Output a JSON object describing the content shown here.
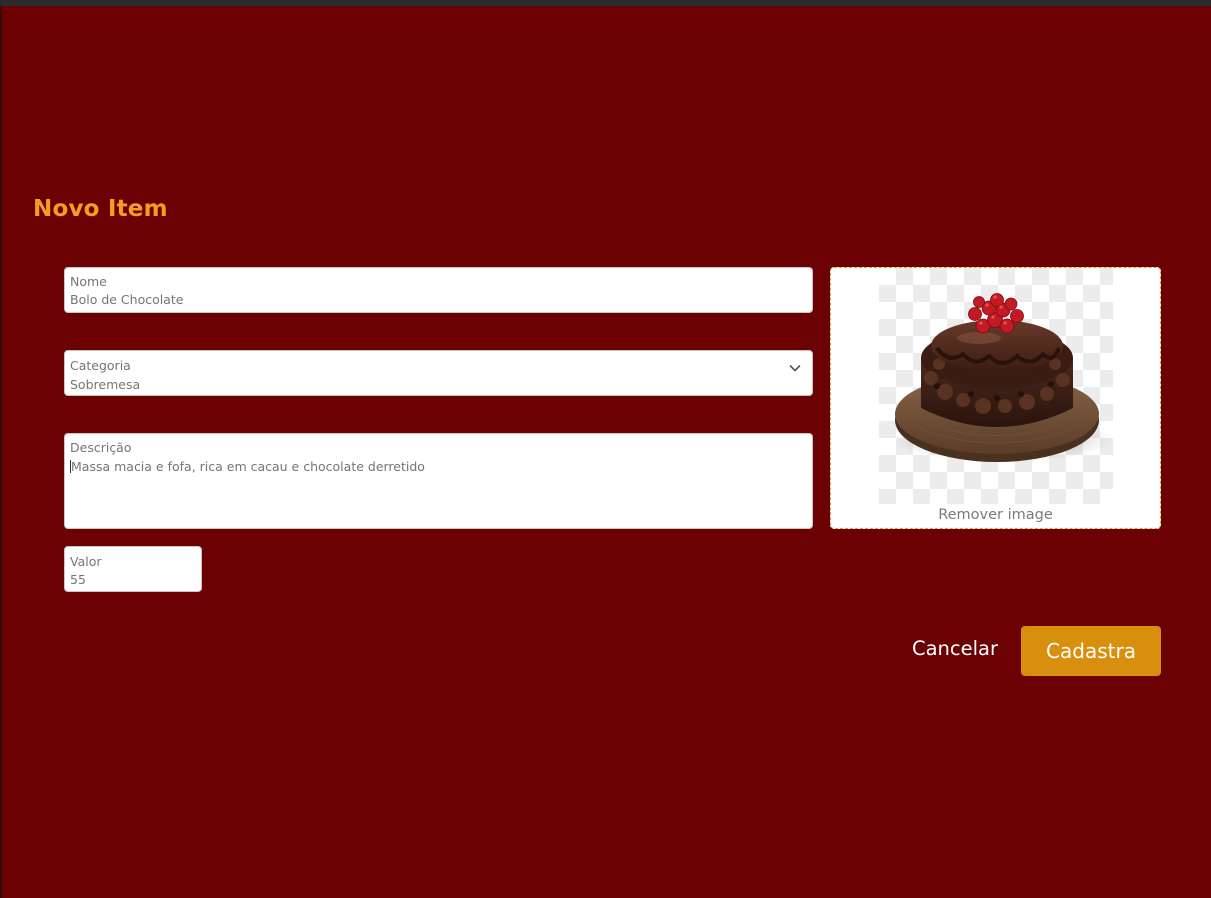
{
  "form": {
    "title": "Novo Item",
    "fields": {
      "nome": {
        "label": "Nome",
        "value": "Bolo de Chocolate"
      },
      "categoria": {
        "label": "Categoria",
        "value": "Sobremesa"
      },
      "descricao": {
        "label": "Descrição",
        "value": "Massa macia e fofa, rica em cacau e chocolate derretido"
      },
      "valor": {
        "label": "Valor",
        "value": "55"
      }
    },
    "image": {
      "remove_label": "Remover image"
    },
    "buttons": {
      "cancel_label": "Cancelar",
      "submit_label": "Cadastra"
    }
  },
  "colors": {
    "background": "#6b0103",
    "title": "#f0a020",
    "submit_button": "#d98f0e",
    "dropzone_border": "#e0a030"
  },
  "icons": {
    "categoria_dropdown": "chevron-down-icon",
    "image_preview": "chocolate-cake-image"
  }
}
